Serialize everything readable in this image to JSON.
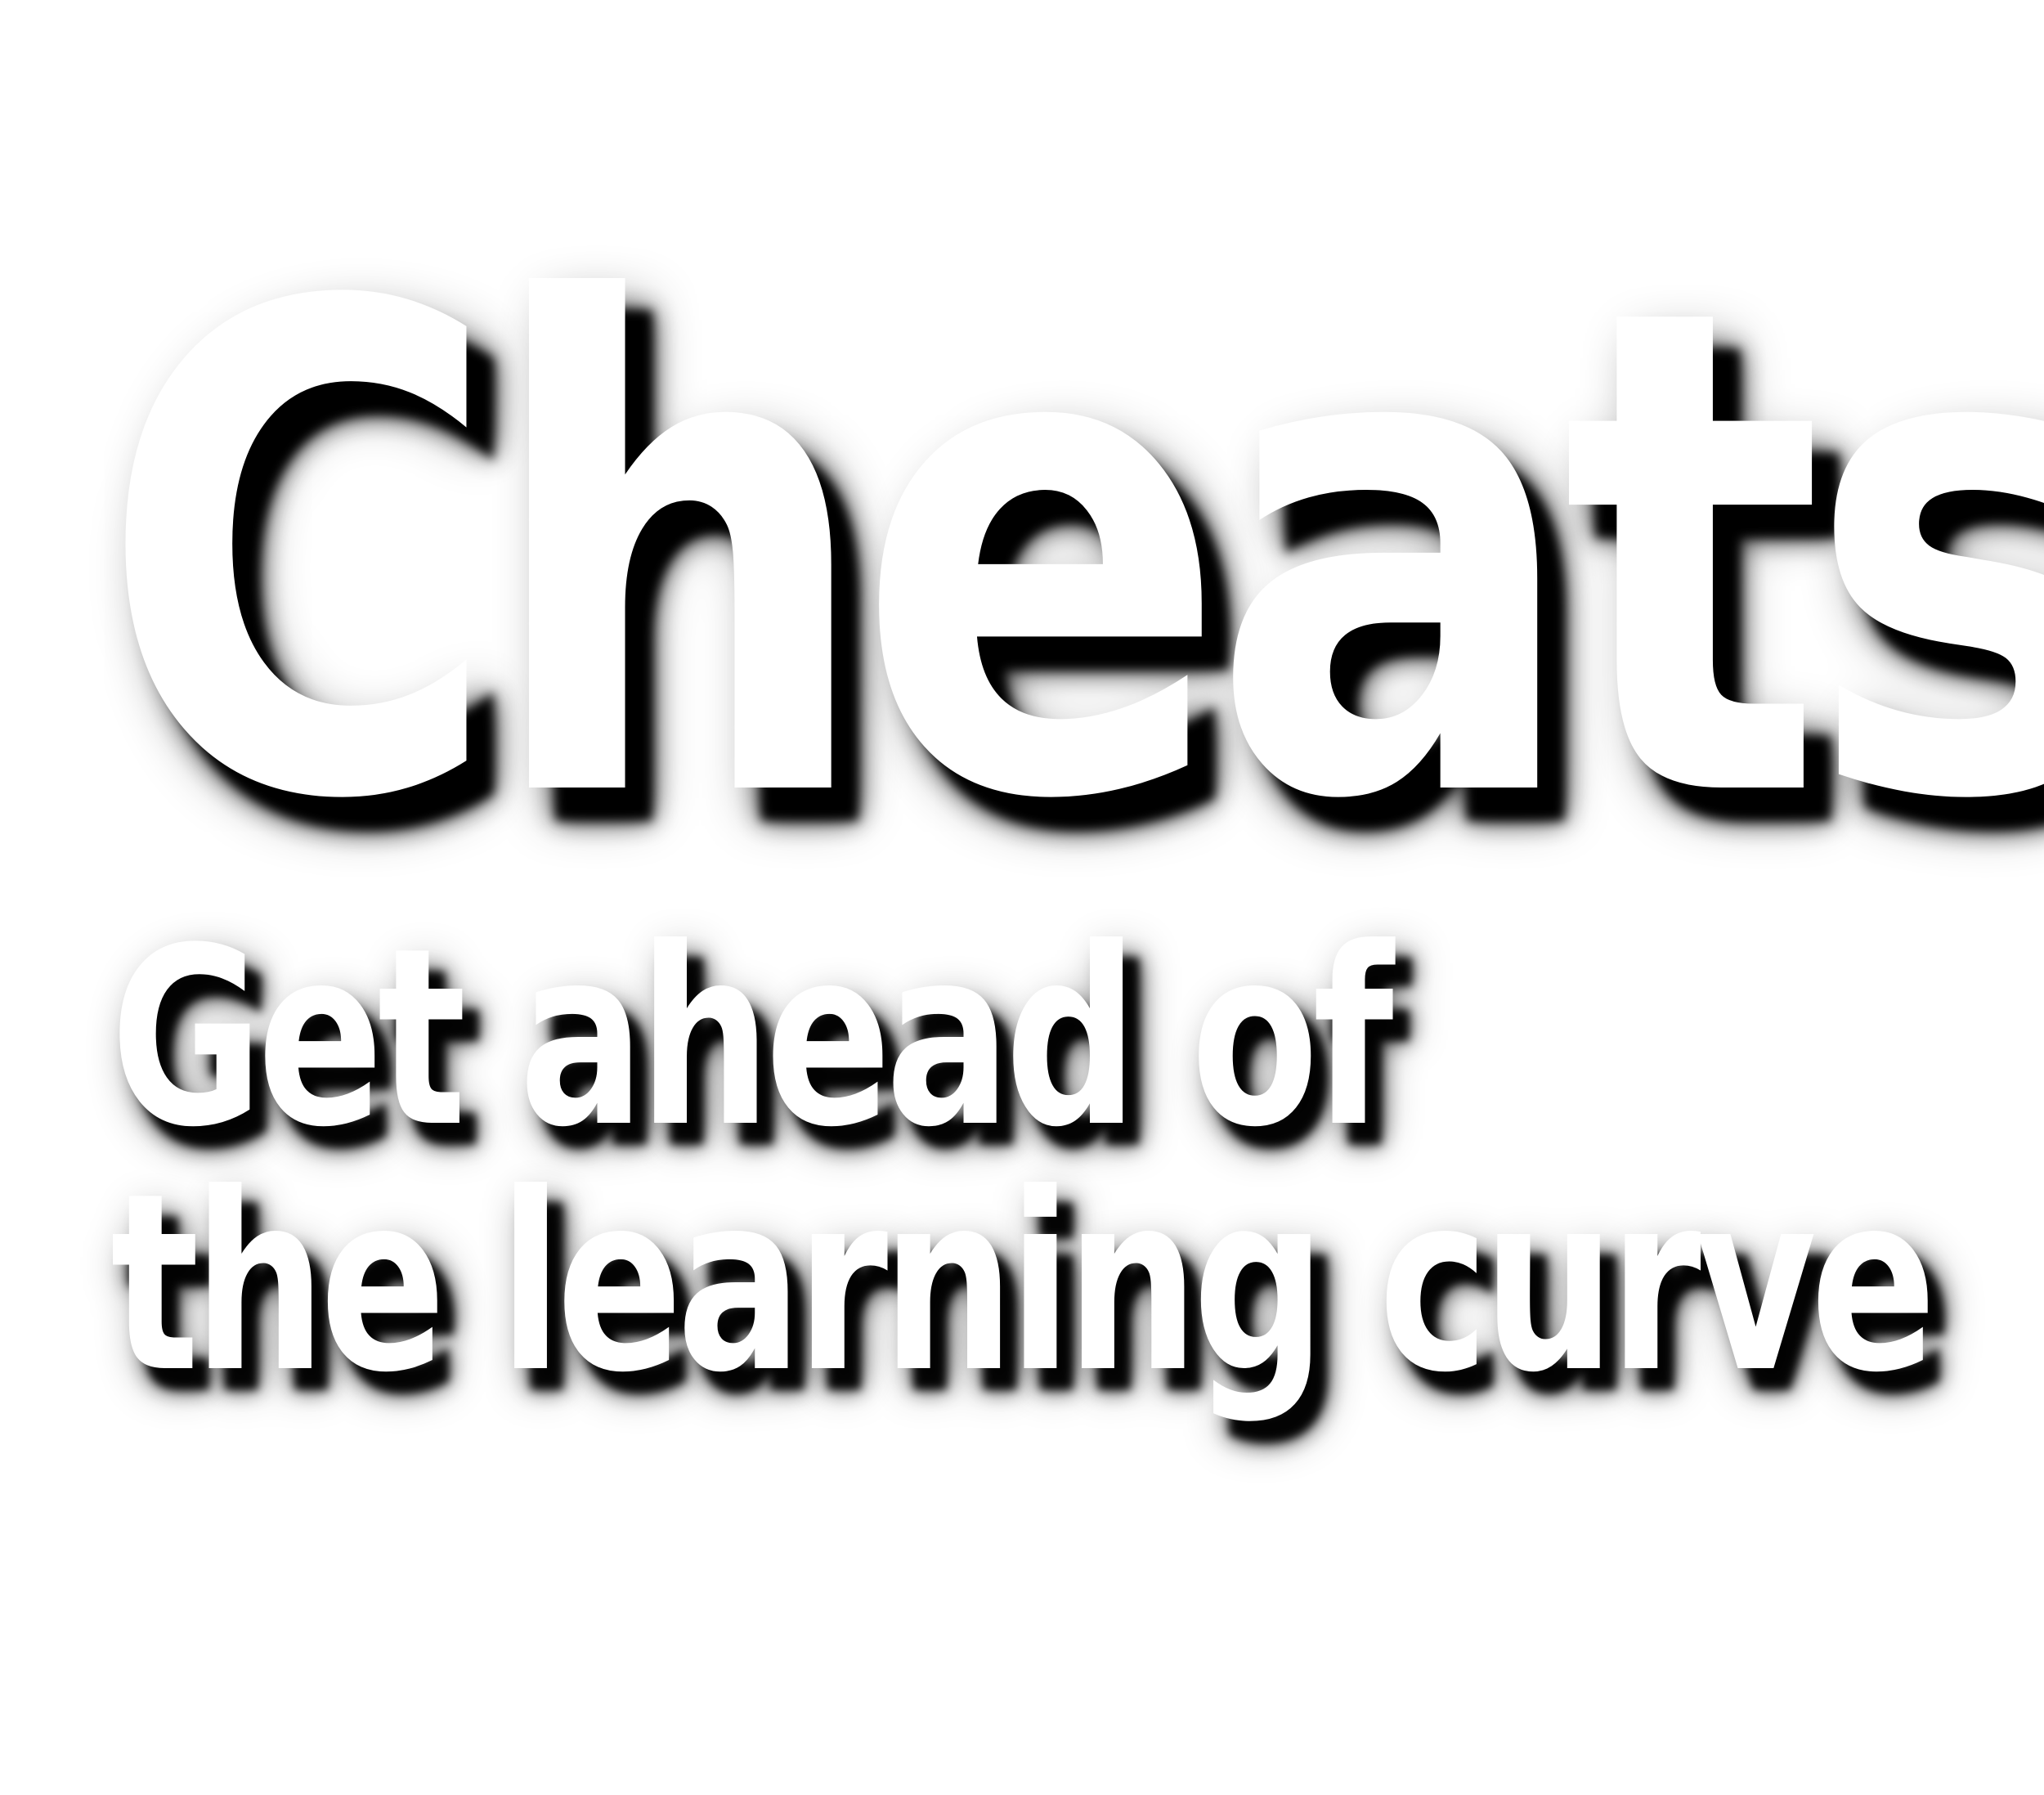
{
  "headline": "Cheats",
  "tagline": {
    "line1": "Get ahead of",
    "line2": "the learning curve"
  },
  "colors": {
    "background": "#ffffff",
    "text": "#ffffff",
    "shadow": "#000000"
  }
}
